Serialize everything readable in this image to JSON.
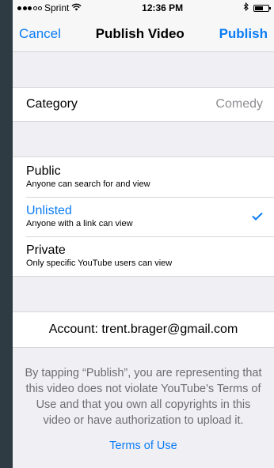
{
  "status": {
    "carrier": "Sprint",
    "signal_dots": 5,
    "signal_filled": 3,
    "time": "12:36 PM",
    "icons": [
      "wifi-icon",
      "bluetooth-icon",
      "battery-icon"
    ]
  },
  "nav": {
    "cancel": "Cancel",
    "title": "Publish Video",
    "publish": "Publish"
  },
  "category": {
    "label": "Category",
    "value": "Comedy"
  },
  "privacy": {
    "options": [
      {
        "title": "Public",
        "subtitle": "Anyone can search for and view",
        "selected": false
      },
      {
        "title": "Unlisted",
        "subtitle": "Anyone with a link can view",
        "selected": true
      },
      {
        "title": "Private",
        "subtitle": "Only specific YouTube users can view",
        "selected": false
      }
    ]
  },
  "account": {
    "text": "Account: trent.brager@gmail.com"
  },
  "legal": {
    "text": "By tapping “Publish”, you are representing that this video does not violate YouTube's Terms of Use and that you own all copyrights in this video or have authorization to upload it.",
    "terms_link": "Terms of Use"
  },
  "colors": {
    "accent": "#0a7cf4",
    "background": "#efeff4",
    "side_panel": "#2f3b43"
  }
}
